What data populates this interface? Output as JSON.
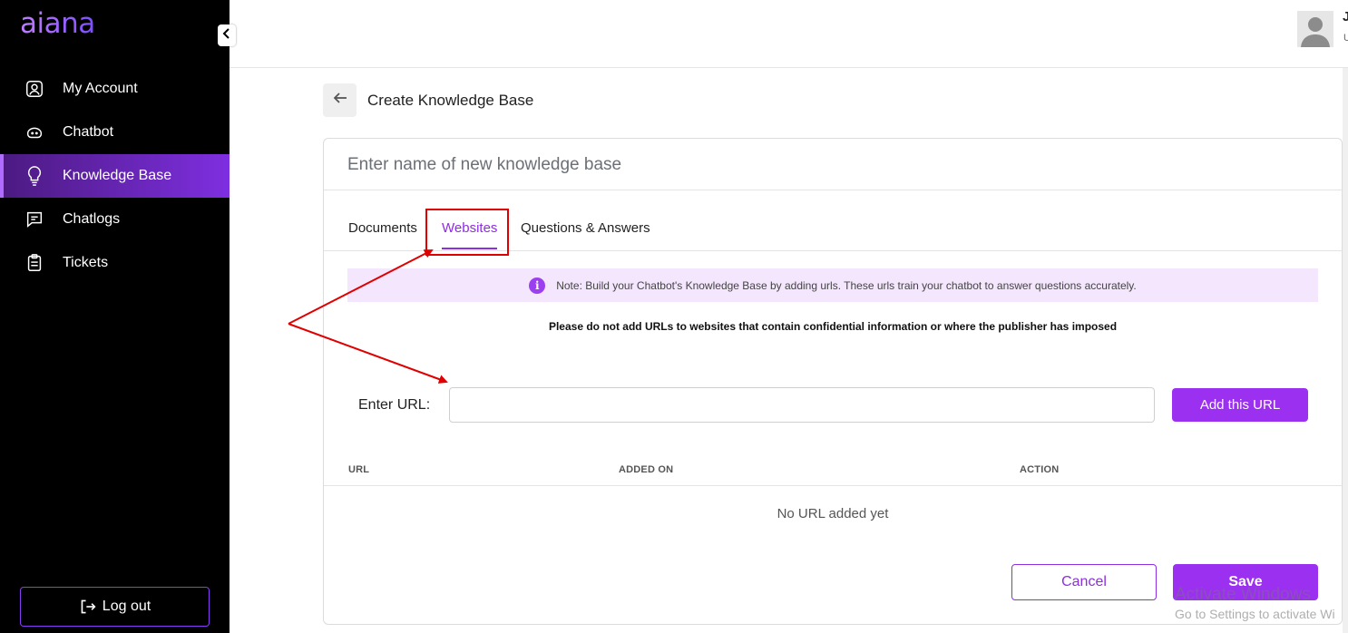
{
  "brand": {
    "logo_text": "aiana"
  },
  "sidebar": {
    "items": [
      {
        "label": "My Account",
        "icon": "user-square-icon"
      },
      {
        "label": "Chatbot",
        "icon": "bot-icon"
      },
      {
        "label": "Knowledge Base",
        "icon": "lightbulb-icon",
        "active": true
      },
      {
        "label": "Chatlogs",
        "icon": "chat-icon"
      },
      {
        "label": "Tickets",
        "icon": "clipboard-icon"
      }
    ],
    "logout_label": "Log out"
  },
  "header": {
    "user_initial": "J",
    "user_sub": "U"
  },
  "page": {
    "title": "Create Knowledge Base"
  },
  "card": {
    "name_placeholder": "Enter name of new knowledge base",
    "tabs": [
      {
        "label": "Documents"
      },
      {
        "label": "Websites",
        "active": true
      },
      {
        "label": "Questions & Answers"
      }
    ],
    "note": "Note: Build your Chatbot's Knowledge Base by adding urls. These urls train your chatbot to answer questions accurately.",
    "warning": "Please do not add URLs to websites that contain confidential information or where the publisher has imposed",
    "url_label": "Enter URL:",
    "url_value": "",
    "add_button": "Add this URL",
    "table": {
      "headers": [
        "URL",
        "ADDED ON",
        "ACTION"
      ],
      "empty_text": "No URL added yet"
    },
    "cancel_label": "Cancel",
    "save_label": "Save"
  },
  "watermark": {
    "line1": "Activate Windows",
    "line2": "Go to Settings to activate Wi"
  },
  "colors": {
    "accent": "#9b30f0",
    "annotation": "#e00000"
  }
}
